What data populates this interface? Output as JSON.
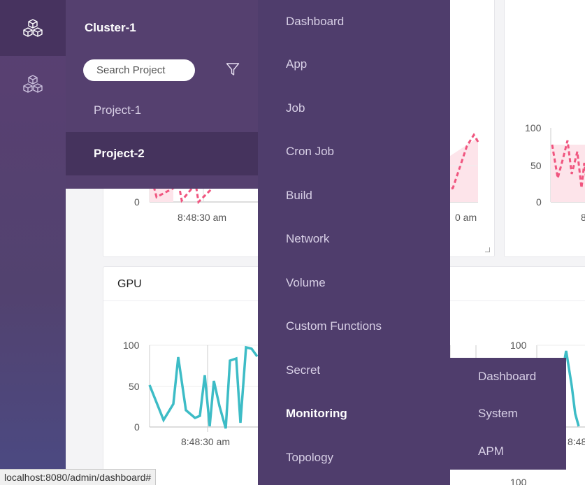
{
  "rail": {
    "icons": [
      "cluster-icon",
      "cluster-outline-icon"
    ]
  },
  "projects": {
    "cluster_title": "Cluster-1",
    "search_placeholder": "Search Project",
    "items": [
      {
        "label": "Project-1",
        "selected": false
      },
      {
        "label": "Project-2",
        "selected": true
      }
    ]
  },
  "menu": {
    "items": [
      {
        "label": "Dashboard"
      },
      {
        "label": "App"
      },
      {
        "label": "Job"
      },
      {
        "label": "Cron Job"
      },
      {
        "label": "Build"
      },
      {
        "label": "Network"
      },
      {
        "label": "Volume"
      },
      {
        "label": "Custom Functions"
      },
      {
        "label": "Secret"
      },
      {
        "label": "Monitoring",
        "active": true
      },
      {
        "label": "Topology"
      }
    ]
  },
  "submenu": {
    "items": [
      {
        "label": "Dashboard"
      },
      {
        "label": "System"
      },
      {
        "label": "APM"
      }
    ]
  },
  "dashboard": {
    "gpu_card_title": "GPU",
    "time_label": "8:48:30 am",
    "time_label_partial_1": "0 am",
    "time_label_partial_2": "8",
    "time_label_partial_3": "8:48",
    "y_ticks_top_left": [
      "0"
    ],
    "y_ticks_top_right": [
      "100",
      "50",
      "0"
    ],
    "y_ticks_gpu": [
      "100",
      "50",
      "0"
    ],
    "y_ticks_gpu_right": [
      "100"
    ],
    "y_tick_bottom_partial": "100"
  },
  "colors": {
    "rail_bg": "#5a3f72",
    "panel_bg": "#55406f",
    "menu_bg": "#4f3d6c",
    "memory_line": "#f0557f",
    "gpu_line": "#3dbcc6"
  },
  "status_bar": {
    "url": "localhost:8080/admin/dashboard#"
  }
}
